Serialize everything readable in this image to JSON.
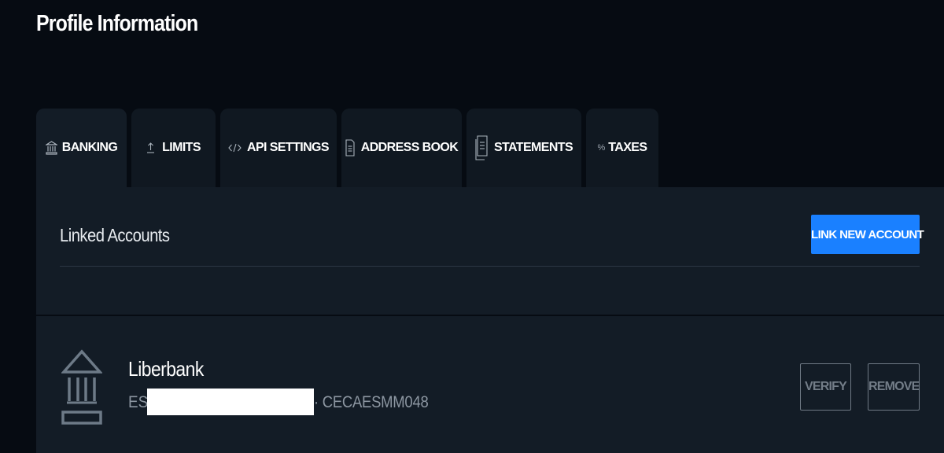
{
  "page": {
    "title": "Profile Information"
  },
  "tabs": [
    {
      "label": "BANKING",
      "icon": "bank-icon",
      "active": true
    },
    {
      "label": "LIMITS",
      "icon": "upload-arrow-icon",
      "active": false
    },
    {
      "label": "API SETTINGS",
      "icon": "code-icon",
      "active": false
    },
    {
      "label": "ADDRESS BOOK",
      "icon": "document-icon",
      "active": false
    },
    {
      "label": "STATEMENTS",
      "icon": "statements-icon",
      "active": false
    },
    {
      "label": "TAXES",
      "icon": "percent-icon",
      "active": false
    }
  ],
  "icons": {
    "percent_symbol": "%"
  },
  "linked_accounts": {
    "title": "Linked Accounts",
    "link_button_label": "LINK NEW ACCOUNT",
    "accounts": [
      {
        "bank_name": "Liberbank",
        "iban_prefix": "ES",
        "swift": "· CECAESMM048",
        "verify_label": "VERIFY",
        "remove_label": "REMOVE"
      }
    ]
  },
  "colors": {
    "background": "#060b12",
    "panel": "#131c26",
    "tab_inactive": "#101821",
    "accent": "#1a80ff",
    "muted_text": "#8c96a1",
    "button_outline": "#6f7984"
  }
}
